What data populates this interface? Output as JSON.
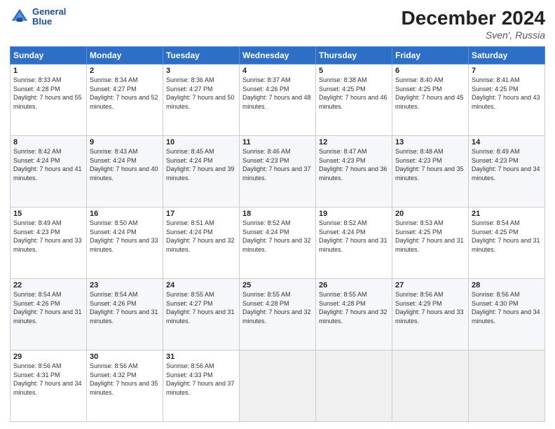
{
  "header": {
    "logo_line1": "General",
    "logo_line2": "Blue",
    "month_title": "December 2024",
    "location": "Sven', Russia"
  },
  "days_of_week": [
    "Sunday",
    "Monday",
    "Tuesday",
    "Wednesday",
    "Thursday",
    "Friday",
    "Saturday"
  ],
  "weeks": [
    [
      {
        "day": "1",
        "sunrise": "Sunrise: 8:33 AM",
        "sunset": "Sunset: 4:28 PM",
        "daylight": "Daylight: 7 hours and 55 minutes."
      },
      {
        "day": "2",
        "sunrise": "Sunrise: 8:34 AM",
        "sunset": "Sunset: 4:27 PM",
        "daylight": "Daylight: 7 hours and 52 minutes."
      },
      {
        "day": "3",
        "sunrise": "Sunrise: 8:36 AM",
        "sunset": "Sunset: 4:27 PM",
        "daylight": "Daylight: 7 hours and 50 minutes."
      },
      {
        "day": "4",
        "sunrise": "Sunrise: 8:37 AM",
        "sunset": "Sunset: 4:26 PM",
        "daylight": "Daylight: 7 hours and 48 minutes."
      },
      {
        "day": "5",
        "sunrise": "Sunrise: 8:38 AM",
        "sunset": "Sunset: 4:25 PM",
        "daylight": "Daylight: 7 hours and 46 minutes."
      },
      {
        "day": "6",
        "sunrise": "Sunrise: 8:40 AM",
        "sunset": "Sunset: 4:25 PM",
        "daylight": "Daylight: 7 hours and 45 minutes."
      },
      {
        "day": "7",
        "sunrise": "Sunrise: 8:41 AM",
        "sunset": "Sunset: 4:25 PM",
        "daylight": "Daylight: 7 hours and 43 minutes."
      }
    ],
    [
      {
        "day": "8",
        "sunrise": "Sunrise: 8:42 AM",
        "sunset": "Sunset: 4:24 PM",
        "daylight": "Daylight: 7 hours and 41 minutes."
      },
      {
        "day": "9",
        "sunrise": "Sunrise: 8:43 AM",
        "sunset": "Sunset: 4:24 PM",
        "daylight": "Daylight: 7 hours and 40 minutes."
      },
      {
        "day": "10",
        "sunrise": "Sunrise: 8:45 AM",
        "sunset": "Sunset: 4:24 PM",
        "daylight": "Daylight: 7 hours and 39 minutes."
      },
      {
        "day": "11",
        "sunrise": "Sunrise: 8:46 AM",
        "sunset": "Sunset: 4:23 PM",
        "daylight": "Daylight: 7 hours and 37 minutes."
      },
      {
        "day": "12",
        "sunrise": "Sunrise: 8:47 AM",
        "sunset": "Sunset: 4:23 PM",
        "daylight": "Daylight: 7 hours and 36 minutes."
      },
      {
        "day": "13",
        "sunrise": "Sunrise: 8:48 AM",
        "sunset": "Sunset: 4:23 PM",
        "daylight": "Daylight: 7 hours and 35 minutes."
      },
      {
        "day": "14",
        "sunrise": "Sunrise: 8:49 AM",
        "sunset": "Sunset: 4:23 PM",
        "daylight": "Daylight: 7 hours and 34 minutes."
      }
    ],
    [
      {
        "day": "15",
        "sunrise": "Sunrise: 8:49 AM",
        "sunset": "Sunset: 4:23 PM",
        "daylight": "Daylight: 7 hours and 33 minutes."
      },
      {
        "day": "16",
        "sunrise": "Sunrise: 8:50 AM",
        "sunset": "Sunset: 4:24 PM",
        "daylight": "Daylight: 7 hours and 33 minutes."
      },
      {
        "day": "17",
        "sunrise": "Sunrise: 8:51 AM",
        "sunset": "Sunset: 4:24 PM",
        "daylight": "Daylight: 7 hours and 32 minutes."
      },
      {
        "day": "18",
        "sunrise": "Sunrise: 8:52 AM",
        "sunset": "Sunset: 4:24 PM",
        "daylight": "Daylight: 7 hours and 32 minutes."
      },
      {
        "day": "19",
        "sunrise": "Sunrise: 8:52 AM",
        "sunset": "Sunset: 4:24 PM",
        "daylight": "Daylight: 7 hours and 31 minutes."
      },
      {
        "day": "20",
        "sunrise": "Sunrise: 8:53 AM",
        "sunset": "Sunset: 4:25 PM",
        "daylight": "Daylight: 7 hours and 31 minutes."
      },
      {
        "day": "21",
        "sunrise": "Sunrise: 8:54 AM",
        "sunset": "Sunset: 4:25 PM",
        "daylight": "Daylight: 7 hours and 31 minutes."
      }
    ],
    [
      {
        "day": "22",
        "sunrise": "Sunrise: 8:54 AM",
        "sunset": "Sunset: 4:26 PM",
        "daylight": "Daylight: 7 hours and 31 minutes."
      },
      {
        "day": "23",
        "sunrise": "Sunrise: 8:54 AM",
        "sunset": "Sunset: 4:26 PM",
        "daylight": "Daylight: 7 hours and 31 minutes."
      },
      {
        "day": "24",
        "sunrise": "Sunrise: 8:55 AM",
        "sunset": "Sunset: 4:27 PM",
        "daylight": "Daylight: 7 hours and 31 minutes."
      },
      {
        "day": "25",
        "sunrise": "Sunrise: 8:55 AM",
        "sunset": "Sunset: 4:28 PM",
        "daylight": "Daylight: 7 hours and 32 minutes."
      },
      {
        "day": "26",
        "sunrise": "Sunrise: 8:55 AM",
        "sunset": "Sunset: 4:28 PM",
        "daylight": "Daylight: 7 hours and 32 minutes."
      },
      {
        "day": "27",
        "sunrise": "Sunrise: 8:56 AM",
        "sunset": "Sunset: 4:29 PM",
        "daylight": "Daylight: 7 hours and 33 minutes."
      },
      {
        "day": "28",
        "sunrise": "Sunrise: 8:56 AM",
        "sunset": "Sunset: 4:30 PM",
        "daylight": "Daylight: 7 hours and 34 minutes."
      }
    ],
    [
      {
        "day": "29",
        "sunrise": "Sunrise: 8:56 AM",
        "sunset": "Sunset: 4:31 PM",
        "daylight": "Daylight: 7 hours and 34 minutes."
      },
      {
        "day": "30",
        "sunrise": "Sunrise: 8:56 AM",
        "sunset": "Sunset: 4:32 PM",
        "daylight": "Daylight: 7 hours and 35 minutes."
      },
      {
        "day": "31",
        "sunrise": "Sunrise: 8:56 AM",
        "sunset": "Sunset: 4:33 PM",
        "daylight": "Daylight: 7 hours and 37 minutes."
      },
      null,
      null,
      null,
      null
    ]
  ]
}
